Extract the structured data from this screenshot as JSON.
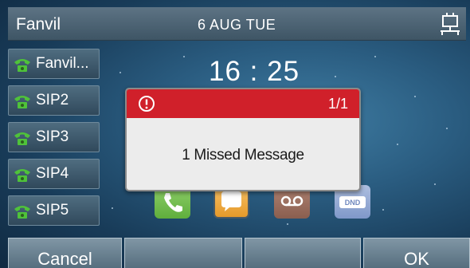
{
  "status_bar": {
    "brand": "Fanvil",
    "date": "6 AUG TUE",
    "network_icon": "network-icon"
  },
  "line_keys": [
    {
      "label": "Fanvil...",
      "icon": "phone-icon"
    },
    {
      "label": "SIP2",
      "icon": "phone-icon"
    },
    {
      "label": "SIP3",
      "icon": "phone-icon"
    },
    {
      "label": "SIP4",
      "icon": "phone-icon"
    },
    {
      "label": "SIP5",
      "icon": "phone-icon"
    }
  ],
  "clock": "16 : 25",
  "apps": [
    {
      "icon": "phone-icon",
      "color": "#6dbb45"
    },
    {
      "icon": "message-icon",
      "color": "#eea93c"
    },
    {
      "icon": "voicemail-icon",
      "color": "#9a6d5d"
    },
    {
      "icon": "dnd-icon",
      "label": "DND",
      "color": "#8ea6d4"
    }
  ],
  "dialog": {
    "count": "1/1",
    "message": "1 Missed Message",
    "header_color": "#d0202a",
    "icon": "alert-icon"
  },
  "softkeys": [
    "Cancel",
    "",
    "",
    "OK"
  ]
}
